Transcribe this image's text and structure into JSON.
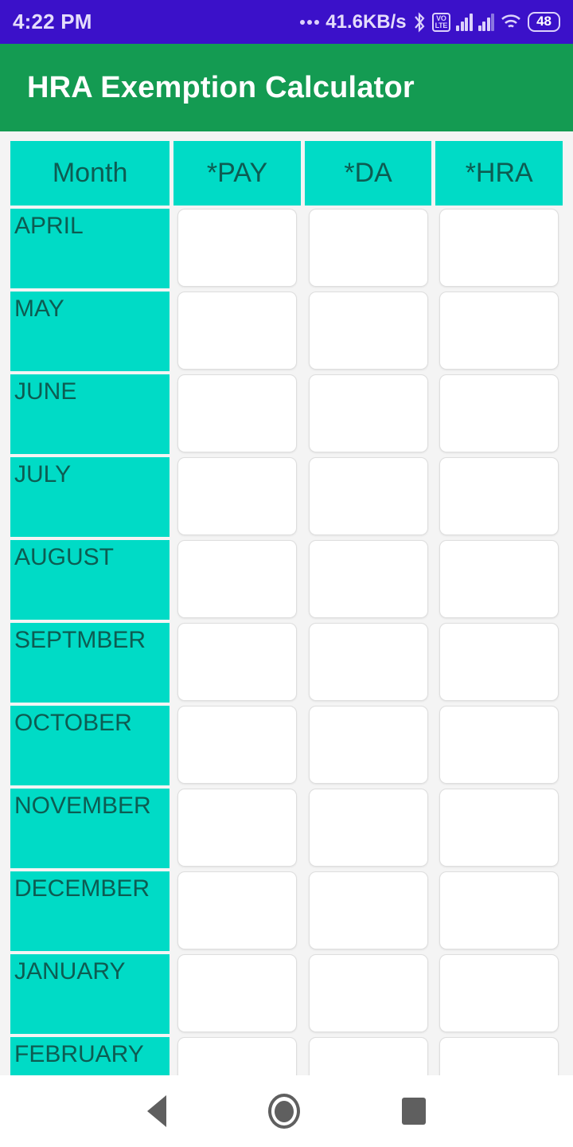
{
  "status_bar": {
    "time": "4:22 PM",
    "network_speed": "41.6KB/s",
    "volte_label_top": "VO",
    "volte_label_bottom": "LTE",
    "battery_level": "48",
    "background_color": "#3b11c9",
    "icons": [
      "ellipsis-icon",
      "bluetooth-icon",
      "volte-icon",
      "signal-bars-icon",
      "signal-bars-icon",
      "wifi-icon",
      "battery-icon"
    ]
  },
  "app_bar": {
    "title": "HRA Exemption Calculator",
    "background_color": "#149b52",
    "text_color": "#ffffff"
  },
  "table": {
    "header_background": "#00dbc6",
    "header_text_color": "#0d5c52",
    "columns": [
      {
        "key": "month",
        "label": "Month"
      },
      {
        "key": "pay",
        "label": "*PAY"
      },
      {
        "key": "da",
        "label": "*DA"
      },
      {
        "key": "hra",
        "label": "*HRA"
      }
    ],
    "rows": [
      {
        "month": "APRIL",
        "pay": "",
        "da": "",
        "hra": ""
      },
      {
        "month": "MAY",
        "pay": "",
        "da": "",
        "hra": ""
      },
      {
        "month": "JUNE",
        "pay": "",
        "da": "",
        "hra": ""
      },
      {
        "month": "JULY",
        "pay": "",
        "da": "",
        "hra": ""
      },
      {
        "month": "AUGUST",
        "pay": "",
        "da": "",
        "hra": ""
      },
      {
        "month": "SEPTMBER",
        "pay": "",
        "da": "",
        "hra": ""
      },
      {
        "month": "OCTOBER",
        "pay": "",
        "da": "",
        "hra": ""
      },
      {
        "month": "NOVEMBER",
        "pay": "",
        "da": "",
        "hra": ""
      },
      {
        "month": "DECEMBER",
        "pay": "",
        "da": "",
        "hra": ""
      },
      {
        "month": "JANUARY",
        "pay": "",
        "da": "",
        "hra": ""
      },
      {
        "month": "FEBRUARY",
        "pay": "",
        "da": "",
        "hra": ""
      }
    ]
  },
  "nav_bar": {
    "back_label": "Back",
    "home_label": "Home",
    "recents_label": "Recents"
  }
}
